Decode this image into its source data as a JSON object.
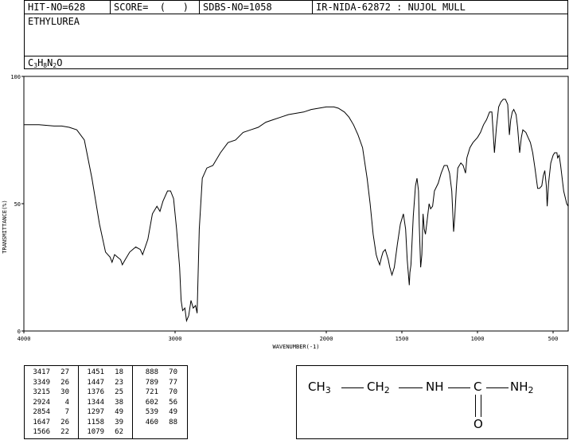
{
  "header": {
    "hit_no": "HIT-NO=628",
    "score": "SCORE=  (   )",
    "sdbs_no": "SDBS-NO=1058",
    "ir_nida": "IR-NIDA-62872 : NUJOL MULL",
    "compound_name": "ETHYLUREA",
    "formula_parts": [
      "C",
      "3",
      "H",
      "8",
      "N",
      "2",
      "O"
    ]
  },
  "chart_data": {
    "type": "line",
    "title": "",
    "xlabel": "WAVENUMBER(-1)",
    "ylabel": "TRANSMITTANCE(%)",
    "xlim": [
      4000,
      400
    ],
    "ylim": [
      0,
      100
    ],
    "x_ticks": [
      4000,
      3000,
      2000,
      1500,
      1000,
      500
    ],
    "y_ticks": [
      0,
      50,
      100
    ],
    "grid": false,
    "legend": "none",
    "series": [
      {
        "color": "#000000",
        "points": [
          [
            4000,
            81
          ],
          [
            3900,
            81
          ],
          [
            3800,
            80.5
          ],
          [
            3750,
            80.5
          ],
          [
            3700,
            80
          ],
          [
            3650,
            79
          ],
          [
            3600,
            75
          ],
          [
            3550,
            60
          ],
          [
            3500,
            42
          ],
          [
            3460,
            31
          ],
          [
            3430,
            29
          ],
          [
            3417,
            27
          ],
          [
            3400,
            30
          ],
          [
            3380,
            29
          ],
          [
            3360,
            28
          ],
          [
            3349,
            26
          ],
          [
            3330,
            28
          ],
          [
            3300,
            31
          ],
          [
            3260,
            33
          ],
          [
            3230,
            32
          ],
          [
            3215,
            30
          ],
          [
            3180,
            36
          ],
          [
            3150,
            46
          ],
          [
            3120,
            49
          ],
          [
            3100,
            47
          ],
          [
            3080,
            51
          ],
          [
            3050,
            55
          ],
          [
            3030,
            55
          ],
          [
            3010,
            52
          ],
          [
            2990,
            40
          ],
          [
            2970,
            25
          ],
          [
            2960,
            12
          ],
          [
            2950,
            8
          ],
          [
            2935,
            9
          ],
          [
            2924,
            4
          ],
          [
            2910,
            6
          ],
          [
            2895,
            12
          ],
          [
            2880,
            9
          ],
          [
            2865,
            10
          ],
          [
            2854,
            7
          ],
          [
            2840,
            40
          ],
          [
            2820,
            60
          ],
          [
            2790,
            64
          ],
          [
            2750,
            65
          ],
          [
            2700,
            70
          ],
          [
            2650,
            74
          ],
          [
            2600,
            75
          ],
          [
            2550,
            78
          ],
          [
            2500,
            79
          ],
          [
            2450,
            80
          ],
          [
            2400,
            82
          ],
          [
            2350,
            83
          ],
          [
            2300,
            84
          ],
          [
            2250,
            85
          ],
          [
            2200,
            85.5
          ],
          [
            2150,
            86
          ],
          [
            2100,
            87
          ],
          [
            2050,
            87.5
          ],
          [
            2000,
            88
          ],
          [
            1950,
            88
          ],
          [
            1920,
            87.5
          ],
          [
            1880,
            86
          ],
          [
            1850,
            84
          ],
          [
            1820,
            81
          ],
          [
            1790,
            77
          ],
          [
            1760,
            72
          ],
          [
            1730,
            60
          ],
          [
            1710,
            50
          ],
          [
            1690,
            38
          ],
          [
            1670,
            30
          ],
          [
            1660,
            28
          ],
          [
            1647,
            26
          ],
          [
            1635,
            29
          ],
          [
            1625,
            31
          ],
          [
            1610,
            32
          ],
          [
            1600,
            30
          ],
          [
            1590,
            28
          ],
          [
            1580,
            25
          ],
          [
            1566,
            22
          ],
          [
            1550,
            25
          ],
          [
            1530,
            34
          ],
          [
            1510,
            42
          ],
          [
            1490,
            46
          ],
          [
            1475,
            40
          ],
          [
            1465,
            28
          ],
          [
            1451,
            18
          ],
          [
            1447,
            23
          ],
          [
            1440,
            26
          ],
          [
            1425,
            45
          ],
          [
            1410,
            57
          ],
          [
            1400,
            60
          ],
          [
            1390,
            55
          ],
          [
            1385,
            42
          ],
          [
            1376,
            25
          ],
          [
            1368,
            30
          ],
          [
            1360,
            46
          ],
          [
            1352,
            40
          ],
          [
            1344,
            38
          ],
          [
            1336,
            42
          ],
          [
            1320,
            50
          ],
          [
            1310,
            48
          ],
          [
            1297,
            49
          ],
          [
            1285,
            55
          ],
          [
            1260,
            58
          ],
          [
            1240,
            62
          ],
          [
            1220,
            65
          ],
          [
            1200,
            65
          ],
          [
            1185,
            62
          ],
          [
            1170,
            55
          ],
          [
            1158,
            39
          ],
          [
            1150,
            45
          ],
          [
            1140,
            56
          ],
          [
            1130,
            64
          ],
          [
            1110,
            66
          ],
          [
            1095,
            65
          ],
          [
            1079,
            62
          ],
          [
            1070,
            68
          ],
          [
            1050,
            72
          ],
          [
            1030,
            74
          ],
          [
            1000,
            76
          ],
          [
            980,
            78
          ],
          [
            960,
            81
          ],
          [
            940,
            83
          ],
          [
            920,
            86
          ],
          [
            905,
            86
          ],
          [
            888,
            70
          ],
          [
            875,
            80
          ],
          [
            860,
            88
          ],
          [
            845,
            90
          ],
          [
            830,
            91
          ],
          [
            815,
            91
          ],
          [
            800,
            89
          ],
          [
            789,
            77
          ],
          [
            780,
            83
          ],
          [
            770,
            86
          ],
          [
            760,
            87
          ],
          [
            745,
            85
          ],
          [
            735,
            80
          ],
          [
            721,
            70
          ],
          [
            710,
            76
          ],
          [
            700,
            79
          ],
          [
            680,
            78
          ],
          [
            665,
            76
          ],
          [
            650,
            74
          ],
          [
            635,
            70
          ],
          [
            620,
            64
          ],
          [
            602,
            56
          ],
          [
            590,
            56
          ],
          [
            575,
            57
          ],
          [
            565,
            61
          ],
          [
            555,
            63
          ],
          [
            545,
            57
          ],
          [
            539,
            49
          ],
          [
            530,
            58
          ],
          [
            515,
            66
          ],
          [
            500,
            69
          ],
          [
            490,
            70
          ],
          [
            475,
            70
          ],
          [
            470,
            68
          ],
          [
            460,
            69
          ],
          [
            450,
            65
          ],
          [
            430,
            55
          ],
          [
            410,
            50
          ],
          [
            400,
            49
          ]
        ]
      }
    ]
  },
  "peak_table": {
    "columns": [
      [
        [
          "3417",
          "27"
        ],
        [
          "3349",
          "26"
        ],
        [
          "3215",
          "30"
        ],
        [
          "2924",
          "4"
        ],
        [
          "2854",
          "7"
        ],
        [
          "1647",
          "26"
        ],
        [
          "1566",
          "22"
        ]
      ],
      [
        [
          "1451",
          "18"
        ],
        [
          "1447",
          "23"
        ],
        [
          "1376",
          "25"
        ],
        [
          "1344",
          "38"
        ],
        [
          "1297",
          "49"
        ],
        [
          "1158",
          "39"
        ],
        [
          "1079",
          "62"
        ]
      ],
      [
        [
          "888",
          "70"
        ],
        [
          "789",
          "77"
        ],
        [
          "721",
          "70"
        ],
        [
          "602",
          "56"
        ],
        [
          "539",
          "49"
        ],
        [
          "460",
          "88"
        ]
      ]
    ]
  },
  "structure": {
    "ch3": "CH",
    "ch3_sub": "3",
    "ch2": "CH",
    "ch2_sub": "2",
    "nh": "NH",
    "c": "C",
    "nh2": "NH",
    "nh2_sub": "2",
    "o": "O"
  }
}
